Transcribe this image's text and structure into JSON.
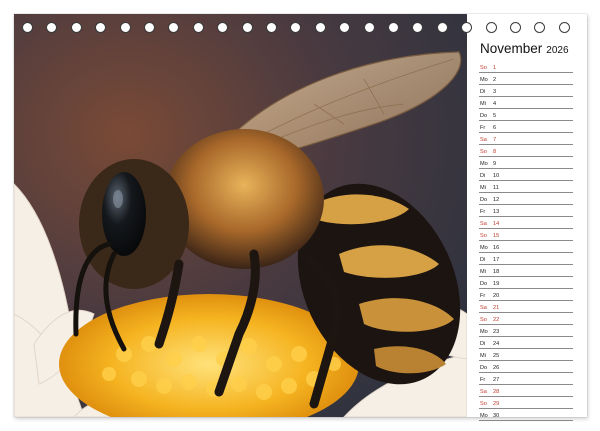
{
  "calendar": {
    "month": "November",
    "year": "2026",
    "days": [
      {
        "dow": "So",
        "day": "1",
        "highlight": true
      },
      {
        "dow": "Mo",
        "day": "2"
      },
      {
        "dow": "Di",
        "day": "3"
      },
      {
        "dow": "Mi",
        "day": "4"
      },
      {
        "dow": "Do",
        "day": "5"
      },
      {
        "dow": "Fr",
        "day": "6"
      },
      {
        "dow": "Sa",
        "day": "7",
        "highlight": true
      },
      {
        "dow": "So",
        "day": "8",
        "highlight": true
      },
      {
        "dow": "Mo",
        "day": "9"
      },
      {
        "dow": "Di",
        "day": "10"
      },
      {
        "dow": "Mi",
        "day": "11"
      },
      {
        "dow": "Do",
        "day": "12"
      },
      {
        "dow": "Fr",
        "day": "13"
      },
      {
        "dow": "Sa",
        "day": "14",
        "highlight": true
      },
      {
        "dow": "So",
        "day": "15",
        "highlight": true
      },
      {
        "dow": "Mo",
        "day": "16"
      },
      {
        "dow": "Di",
        "day": "17"
      },
      {
        "dow": "Mi",
        "day": "18"
      },
      {
        "dow": "Do",
        "day": "19"
      },
      {
        "dow": "Fr",
        "day": "20"
      },
      {
        "dow": "Sa",
        "day": "21",
        "highlight": true
      },
      {
        "dow": "So",
        "day": "22",
        "highlight": true
      },
      {
        "dow": "Mo",
        "day": "23"
      },
      {
        "dow": "Di",
        "day": "24"
      },
      {
        "dow": "Mi",
        "day": "25"
      },
      {
        "dow": "Do",
        "day": "26"
      },
      {
        "dow": "Fr",
        "day": "27"
      },
      {
        "dow": "Sa",
        "day": "28",
        "highlight": true
      },
      {
        "dow": "So",
        "day": "29",
        "highlight": true
      },
      {
        "dow": "Mo",
        "day": "30"
      }
    ]
  },
  "colors": {
    "weekend": "#c0392b",
    "line": "#8a8a8a",
    "text": "#222222"
  },
  "photo": {
    "subject": "bee-on-flower"
  },
  "binding_hole_count": 23
}
